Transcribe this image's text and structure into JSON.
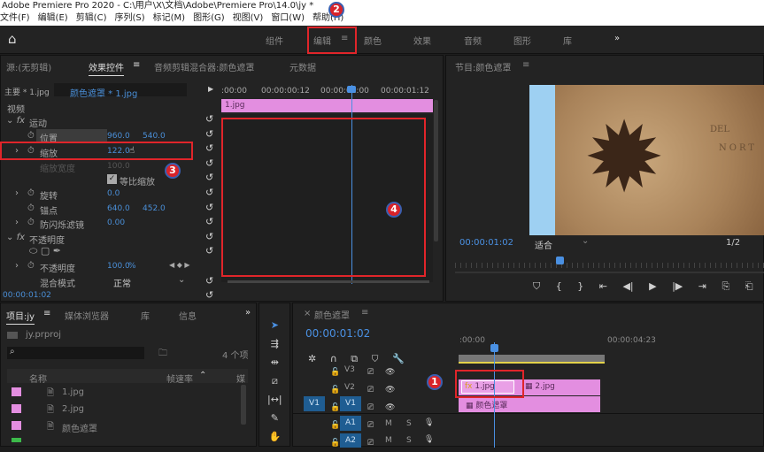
{
  "window": {
    "title": "Adobe Premiere Pro 2020 - C:\\用户\\X\\文档\\Adobe\\Premiere Pro\\14.0\\jy *"
  },
  "menu": [
    "文件(F)",
    "编辑(E)",
    "剪辑(C)",
    "序列(S)",
    "标记(M)",
    "图形(G)",
    "视图(V)",
    "窗口(W)",
    "帮助(H)"
  ],
  "workspaces": {
    "items": [
      "组件",
      "编辑",
      "颜色",
      "效果",
      "音频",
      "图形",
      "库"
    ],
    "active": "编辑",
    "more": "»"
  },
  "effect_controls": {
    "tabs": [
      "源:(无剪辑)",
      "效果控件",
      "音频剪辑混合器:颜色遮罩",
      "元数据"
    ],
    "master": "主要 * 1.jpg",
    "clip": "颜色遮罩 * 1.jpg",
    "ruler": [
      ":00:00",
      "00:00:00:12",
      "00:00:01:00",
      "00:00:01:12"
    ],
    "clip_bar": "1.jpg",
    "section": "视频",
    "motion": "运动",
    "props": [
      {
        "name": "位置",
        "v1": "960.0",
        "v2": "540.0"
      },
      {
        "name": "缩放",
        "v1": "122.0",
        "v2": ""
      },
      {
        "name": "缩放宽度",
        "v1": "100.0",
        "v2": ""
      },
      {
        "name": "旋转",
        "v1": "0.0",
        "v2": ""
      },
      {
        "name": "锚点",
        "v1": "640.0",
        "v2": "452.0"
      },
      {
        "name": "防闪烁滤镜",
        "v1": "0.00",
        "v2": ""
      }
    ],
    "uniform_scale": "等比缩放",
    "opacity_group": "不透明度",
    "opacity": {
      "name": "不透明度",
      "value": "100.0",
      "unit": "%"
    },
    "blend": {
      "name": "混合模式",
      "value": "正常"
    },
    "timecode": "00:00:01:02"
  },
  "program": {
    "title": "节目:颜色遮罩",
    "timecode": "00:00:01:02",
    "fit": "适合",
    "resolution": "1/2",
    "map_text": [
      "DEL",
      "NORT"
    ]
  },
  "project": {
    "tabs": [
      "项目:jy",
      "媒体浏览器",
      "库",
      "信息"
    ],
    "file": "jy.prproj",
    "count": "4 个项",
    "columns": [
      "名称",
      "帧速率",
      "媒"
    ],
    "items": [
      {
        "name": "1.jpg",
        "color": "#e38ee0"
      },
      {
        "name": "2.jpg",
        "color": "#e38ee0"
      },
      {
        "name": "颜色遮罩",
        "color": "#e38ee0"
      }
    ]
  },
  "timeline": {
    "title": "颜色遮罩",
    "timecode": "00:00:01:02",
    "ruler": [
      ":00:00",
      "00:00:04:23"
    ],
    "tracks": [
      "V3",
      "V2",
      "V1",
      "A1",
      "A2"
    ],
    "source_patch": "V1",
    "clips": {
      "v2a": "1.jpg",
      "v2b": "2.jpg",
      "v1": "颜色遮罩"
    },
    "ms": [
      "M",
      "S"
    ]
  },
  "annotations": [
    "1",
    "2",
    "3",
    "4"
  ],
  "colors": {
    "accent": "#4a90e2",
    "clip": "#e38ee0",
    "highlight": "#e0252a"
  }
}
